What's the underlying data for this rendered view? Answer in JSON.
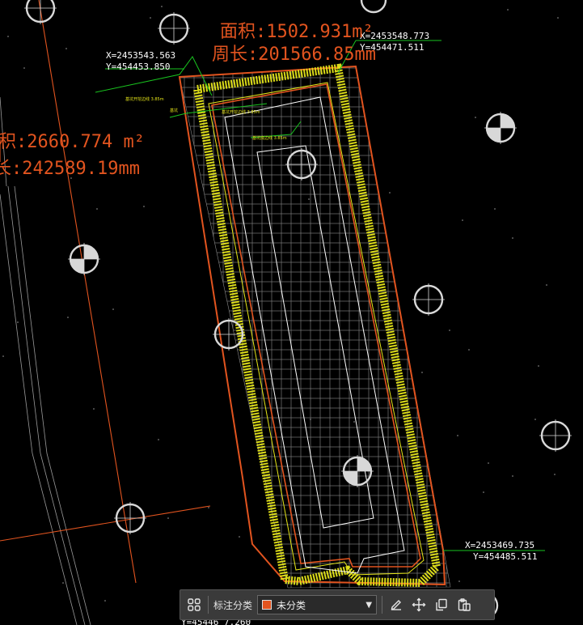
{
  "drawing": {
    "area_large": "积:2660.774 m²",
    "perimeter_large": "长:242589.19mm",
    "area_small": "面积:1502.931m²",
    "perimeter_small": "周长:201566.85mm",
    "coord_tl_x": "X=2453543.563",
    "coord_tl_y": "Y=454453.850",
    "coord_tr_x": "X=2453548.773",
    "coord_tr_y": "Y=454471.511",
    "coord_br_x": "X=2453469.735",
    "coord_br_y": "Y=454485.511",
    "coord_bottom_partial": "Y=45446 7.260",
    "colors": {
      "boundary": "#e2541f",
      "leader": "#19c41f",
      "hatch": "#e6e619",
      "grid": "#8a8a8a"
    }
  },
  "toolbar": {
    "grid_icon": "grid-icon",
    "category_label": "标注分类",
    "category_value": "未分类",
    "category_color": "#e2541f",
    "edit_icon": "edit-icon",
    "move_icon": "move-icon",
    "copy_icon": "copy-icon",
    "paste_icon": "paste-icon"
  }
}
